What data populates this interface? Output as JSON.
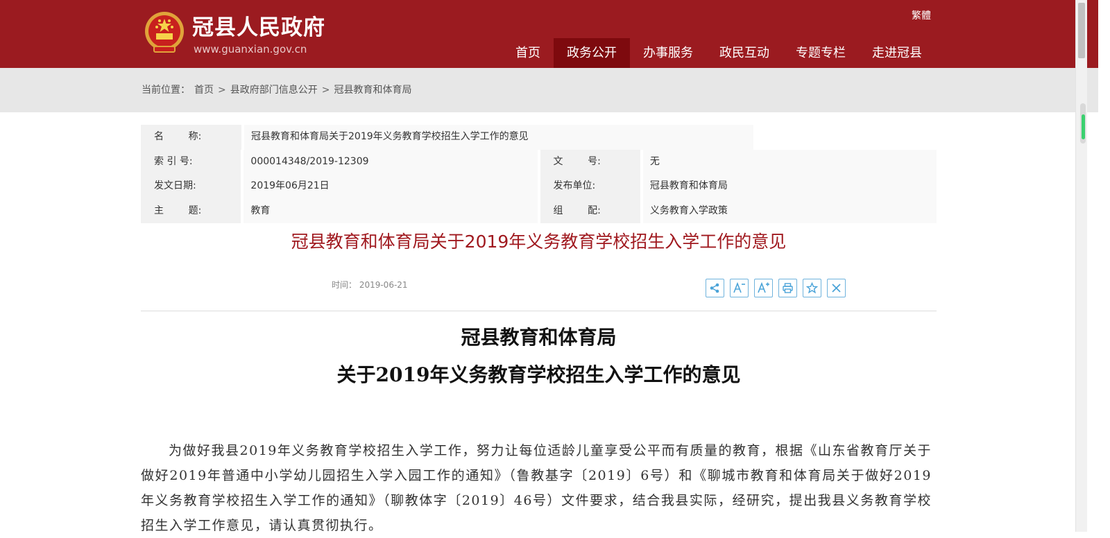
{
  "header": {
    "site_title": "冠县人民政府",
    "site_url": "www.guanxian.gov.cn",
    "lang_switch": "繁體",
    "nav": [
      {
        "label": "首页",
        "active": false
      },
      {
        "label": "政务公开",
        "active": true
      },
      {
        "label": "办事服务",
        "active": false
      },
      {
        "label": "政民互动",
        "active": false
      },
      {
        "label": "专题专栏",
        "active": false
      },
      {
        "label": "走进冠县",
        "active": false
      }
    ],
    "colors": {
      "brand": "#9b1b20",
      "nav_active": "#7e0a0e"
    }
  },
  "breadcrumb": {
    "prefix": "当前位置：",
    "items": [
      "首页",
      "县政府部门信息公开",
      "冠县教育和体育局"
    ],
    "separator": ">"
  },
  "info": {
    "name_label": "名        称:",
    "name_value": "冠县教育和体育局关于2019年义务教育学校招生入学工作的意见",
    "index_label": "索 引 号:",
    "index_value": "000014348/2019-12309",
    "docno_label": "文        号:",
    "docno_value": "无",
    "date_label": "发文日期:",
    "date_value": "2019年06月21日",
    "publisher_label": "发布单位:",
    "publisher_value": "冠县教育和体育局",
    "topic_label": "主        题:",
    "topic_value": "教育",
    "group_label": "组        配:",
    "group_value": "义务教育入学政策"
  },
  "article": {
    "title": "冠县教育和体育局关于2019年义务教育学校招生入学工作的意见",
    "time": "时间：  2019-06-21",
    "tools": [
      "share-icon",
      "font-decrease-icon",
      "font-increase-icon",
      "print-icon",
      "favorite-icon",
      "close-icon"
    ],
    "doc_title_line1": "冠县教育和体育局",
    "doc_title_line2": "关于2019年义务教育学校招生入学工作的意见",
    "body": "为做好我县2019年义务教育学校招生入学工作，努力让每位适龄儿童享受公平而有质量的教育，根据《山东省教育厅关于做好2019年普通中小学幼儿园招生入学入园工作的通知》（鲁教基字〔2019〕6号）和《聊城市教育和体育局关于做好2019年义务教育学校招生入学工作的通知》（聊教体字〔2019〕46号）文件要求，结合我县实际，经研究，提出我县义务教育学校招生入学工作意见，请认真贯彻执行。"
  }
}
